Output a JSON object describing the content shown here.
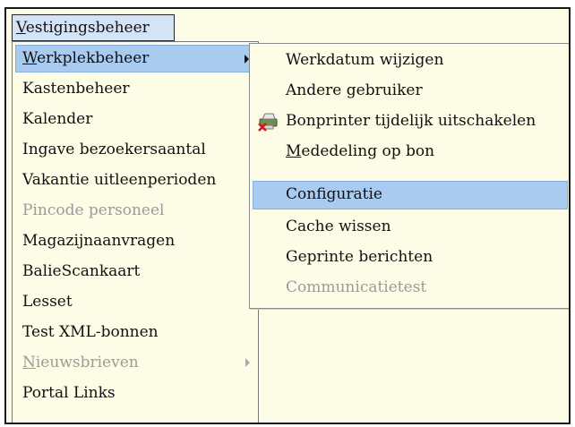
{
  "menubar": {
    "title_first": "V",
    "title_rest": "estigingsbeheer"
  },
  "main_menu": {
    "items": [
      {
        "accel": "W",
        "rest": "erkplekbeheer"
      },
      {
        "label": "Kastenbeheer"
      },
      {
        "label": "Kalender"
      },
      {
        "label": "Ingave bezoekersaantal"
      },
      {
        "label": "Vakantie uitleenperioden"
      },
      {
        "label": "Pincode personeel"
      },
      {
        "label": "Magazijnaanvragen"
      },
      {
        "label": "BalieScankaart"
      },
      {
        "label": "Lesset"
      },
      {
        "label": "Test XML-bonnen"
      },
      {
        "accel": "N",
        "rest": "ieuwsbrieven"
      },
      {
        "label": "Portal Links"
      }
    ]
  },
  "submenu": {
    "items": [
      {
        "label": "Werkdatum wijzigen"
      },
      {
        "label": "Andere gebruiker"
      },
      {
        "label": "Bonprinter tijdelijk uitschakelen",
        "icon": "printer-disabled-icon"
      },
      {
        "accel": "M",
        "rest": "ededeling op bon"
      },
      {
        "label": "Configuratie"
      },
      {
        "label": "Cache wissen"
      },
      {
        "label": "Geprinte berichten"
      },
      {
        "label": "Communicatietest"
      }
    ]
  },
  "colors": {
    "menu_background": "#fdfce6",
    "highlight": "#a9cbf0",
    "disabled_text": "#9b9b9b"
  }
}
